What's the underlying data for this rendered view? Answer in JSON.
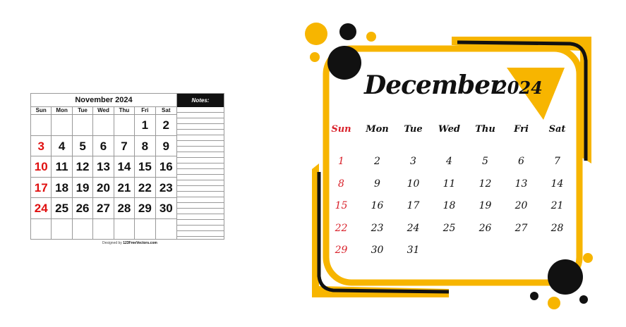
{
  "november": {
    "title": "November 2024",
    "weekdays": [
      "Sun",
      "Mon",
      "Tue",
      "Wed",
      "Thu",
      "Fri",
      "Sat"
    ],
    "days": [
      "",
      "",
      "",
      "",
      "",
      "1",
      "2",
      "3",
      "4",
      "5",
      "6",
      "7",
      "8",
      "9",
      "10",
      "11",
      "12",
      "13",
      "14",
      "15",
      "16",
      "17",
      "18",
      "19",
      "20",
      "21",
      "22",
      "23",
      "24",
      "25",
      "26",
      "27",
      "28",
      "29",
      "30",
      "",
      "",
      "",
      "",
      "",
      "",
      ""
    ],
    "notes_label": "Notes:",
    "credit_prefix": "Designed by",
    "credit_site": "123FreeVectors.com",
    "sunday_color": "#e01010"
  },
  "december": {
    "month": "December",
    "year": "2024",
    "weekdays": [
      "Sun",
      "Mon",
      "Tue",
      "Wed",
      "Thu",
      "Fri",
      "Sat"
    ],
    "days": [
      "1",
      "2",
      "3",
      "4",
      "5",
      "6",
      "7",
      "8",
      "9",
      "10",
      "11",
      "12",
      "13",
      "14",
      "15",
      "16",
      "17",
      "18",
      "19",
      "20",
      "21",
      "22",
      "23",
      "24",
      "25",
      "26",
      "27",
      "28",
      "29",
      "30",
      "31"
    ],
    "accent_color": "#f7b500",
    "sunday_color": "#d9202a"
  }
}
